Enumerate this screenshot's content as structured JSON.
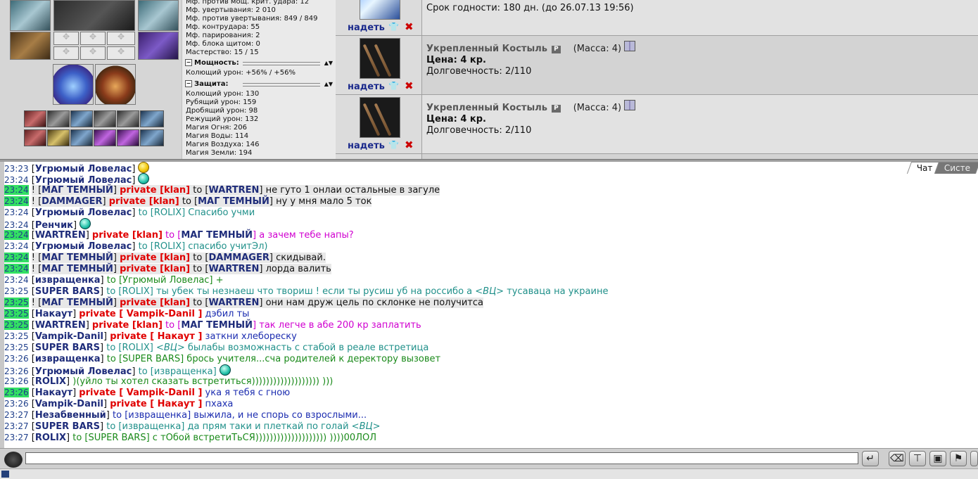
{
  "stats": {
    "lines_top": [
      "Мф. против мощ. крит. удара: 12",
      "Мф. увертывания: 2 010",
      "Мф. против увертывания: 849 / 849",
      "Мф. контрудара: 55",
      "Мф. парирования: 2",
      "Мф. блока щитом: 0",
      "Мастерство: 15 / 15"
    ],
    "power_section": {
      "title": "Мощность:",
      "lines": [
        "Колющий урон: +56% / +56%"
      ]
    },
    "defense_section": {
      "title": "Защита:",
      "lines": [
        "Колющий урон: 130",
        "Рубящий урон: 159",
        "Дробящий урон: 98",
        "Режущий урон: 132",
        "Магия Огня: 206",
        "Магия Воды: 114",
        "Магия Воздуха: 146",
        "Магия Земли: 194"
      ]
    }
  },
  "items": {
    "first": {
      "expiry": "Срок годности: 180 дн. (до 26.07.13 19:56)",
      "put_label": "надеть"
    },
    "list": [
      {
        "name": "Укрепленный Костыль",
        "badge": "P",
        "mass": "(Масса: 4)",
        "price": "Цена: 4 кр.",
        "durability": "Долговечность: 2/110",
        "put_label": "надеть"
      },
      {
        "name": "Укрепленный Костыль",
        "badge": "P",
        "mass": "(Масса: 4)",
        "price": "Цена: 4 кр.",
        "durability": "Долговечность: 2/110",
        "put_label": "надеть"
      }
    ]
  },
  "chat": {
    "tabs": [
      "Чат",
      "Систе"
    ],
    "lines": [
      {
        "time": "23:23",
        "priv": false,
        "parts": [
          {
            "t": "[",
            "c": "c-black"
          },
          {
            "t": "Угрюмый Ловелас",
            "c": "nm"
          },
          {
            "t": "]",
            "c": "c-black"
          }
        ],
        "smile": "yellow"
      },
      {
        "time": "23:24",
        "priv": false,
        "parts": [
          {
            "t": "[",
            "c": "c-black"
          },
          {
            "t": "Угрюмый Ловелас",
            "c": "nm"
          },
          {
            "t": "]",
            "c": "c-black"
          }
        ],
        "smile": "cyan"
      },
      {
        "time": "23:24",
        "priv": true,
        "parts": [
          {
            "t": "! [",
            "c": "c-black hl"
          },
          {
            "t": "МАГ ТЕМНЫЙ",
            "c": "nm hl"
          },
          {
            "t": "] ",
            "c": "c-black hl"
          },
          {
            "t": "private [klan]",
            "c": "pv hl"
          },
          {
            "t": " to [",
            "c": "c-black hl"
          },
          {
            "t": "WARTREN",
            "c": "nm hl"
          },
          {
            "t": "] не гуто 1 онлаи остальные в загуле",
            "c": "c-black hl"
          }
        ]
      },
      {
        "time": "23:24",
        "priv": true,
        "parts": [
          {
            "t": "! [",
            "c": "c-black hl"
          },
          {
            "t": "DAMMAGER",
            "c": "nm hl"
          },
          {
            "t": "] ",
            "c": "c-black hl"
          },
          {
            "t": "private [klan]",
            "c": "pv hl"
          },
          {
            "t": " to [",
            "c": "c-black hl"
          },
          {
            "t": "МАГ ТЕМНЫЙ",
            "c": "nm hl"
          },
          {
            "t": "] ну у мня мало 5 ток",
            "c": "c-black hl"
          }
        ]
      },
      {
        "time": "23:24",
        "priv": false,
        "parts": [
          {
            "t": "[",
            "c": "c-black"
          },
          {
            "t": "Угрюмый Ловелас",
            "c": "nm"
          },
          {
            "t": "] ",
            "c": "c-black"
          },
          {
            "t": "to [ROLIX] Спасибо учми",
            "c": "c-teal"
          }
        ]
      },
      {
        "time": "23:24",
        "priv": false,
        "parts": [
          {
            "t": "[",
            "c": "c-black"
          },
          {
            "t": "Ренчик",
            "c": "nm"
          },
          {
            "t": "]",
            "c": "c-black"
          }
        ],
        "smile": "cyan"
      },
      {
        "time": "23:24",
        "priv": true,
        "parts": [
          {
            "t": "[",
            "c": "c-black"
          },
          {
            "t": "WARTREN",
            "c": "nm"
          },
          {
            "t": "] ",
            "c": "c-black"
          },
          {
            "t": "private [klan]",
            "c": "pv"
          },
          {
            "t": " to [",
            "c": "c-mag"
          },
          {
            "t": "МАГ ТЕМНЫЙ",
            "c": "nm"
          },
          {
            "t": "] а зачем тебе напы?",
            "c": "c-mag"
          }
        ]
      },
      {
        "time": "23:24",
        "priv": false,
        "parts": [
          {
            "t": "[",
            "c": "c-black"
          },
          {
            "t": "Угрюмый Ловелас",
            "c": "nm"
          },
          {
            "t": "] ",
            "c": "c-black"
          },
          {
            "t": "to [ROLIX] спасибо учитЭл)",
            "c": "c-teal"
          }
        ]
      },
      {
        "time": "23:24",
        "priv": true,
        "parts": [
          {
            "t": "! [",
            "c": "c-black hl"
          },
          {
            "t": "МАГ ТЕМНЫЙ",
            "c": "nm hl"
          },
          {
            "t": "] ",
            "c": "c-black hl"
          },
          {
            "t": "private [klan]",
            "c": "pv hl"
          },
          {
            "t": " to [",
            "c": "c-black hl"
          },
          {
            "t": "DAMMAGER",
            "c": "nm hl"
          },
          {
            "t": "] скидывай.",
            "c": "c-black hl"
          }
        ]
      },
      {
        "time": "23:24",
        "priv": true,
        "parts": [
          {
            "t": "! [",
            "c": "c-black hl"
          },
          {
            "t": "МАГ ТЕМНЫЙ",
            "c": "nm hl"
          },
          {
            "t": "] ",
            "c": "c-black hl"
          },
          {
            "t": "private [klan]",
            "c": "pv hl"
          },
          {
            "t": " to [",
            "c": "c-black hl"
          },
          {
            "t": "WARTREN",
            "c": "nm hl"
          },
          {
            "t": "] лорда валить",
            "c": "c-black hl"
          }
        ]
      },
      {
        "time": "23:24",
        "priv": false,
        "parts": [
          {
            "t": "[",
            "c": "c-black"
          },
          {
            "t": "извращенка",
            "c": "nm"
          },
          {
            "t": "] ",
            "c": "c-black"
          },
          {
            "t": "to [Угрюмый Ловелас] +",
            "c": "c-green"
          }
        ]
      },
      {
        "time": "23:25",
        "priv": false,
        "parts": [
          {
            "t": "[",
            "c": "c-black"
          },
          {
            "t": "SUPER BARS",
            "c": "nm"
          },
          {
            "t": "] ",
            "c": "c-black"
          },
          {
            "t": "to [ROLIX] ты убек ты незнаеш что твориш ! если ты русиш уб на россибо а ",
            "c": "c-teal"
          },
          {
            "t": "<ВЦ>",
            "c": "c-teal vc"
          },
          {
            "t": " тусаваца на украине",
            "c": "c-teal"
          }
        ]
      },
      {
        "time": "23:25",
        "priv": true,
        "parts": [
          {
            "t": "! [",
            "c": "c-black hl"
          },
          {
            "t": "МАГ ТЕМНЫЙ",
            "c": "nm hl"
          },
          {
            "t": "] ",
            "c": "c-black hl"
          },
          {
            "t": "private [klan]",
            "c": "pv hl"
          },
          {
            "t": " to [",
            "c": "c-black hl"
          },
          {
            "t": "WARTREN",
            "c": "nm hl"
          },
          {
            "t": "] они нам друж цель по склонке не получитса",
            "c": "c-black hl"
          }
        ]
      },
      {
        "time": "23:25",
        "priv": true,
        "parts": [
          {
            "t": "[",
            "c": "c-black"
          },
          {
            "t": "Накаут",
            "c": "nm"
          },
          {
            "t": "] ",
            "c": "c-black"
          },
          {
            "t": "private [ Vampik-Danil ]",
            "c": "pv"
          },
          {
            "t": " дэбил ты",
            "c": "c-blue"
          }
        ]
      },
      {
        "time": "23:25",
        "priv": true,
        "parts": [
          {
            "t": "[",
            "c": "c-black"
          },
          {
            "t": "WARTREN",
            "c": "nm"
          },
          {
            "t": "] ",
            "c": "c-black"
          },
          {
            "t": "private [klan]",
            "c": "pv"
          },
          {
            "t": " to [",
            "c": "c-mag"
          },
          {
            "t": "МАГ ТЕМНЫЙ",
            "c": "nm"
          },
          {
            "t": "] так легче в абе 200 кр заплатить",
            "c": "c-mag"
          }
        ]
      },
      {
        "time": "23:25",
        "priv": false,
        "parts": [
          {
            "t": "[",
            "c": "c-black"
          },
          {
            "t": "Vampik-Danil",
            "c": "nm"
          },
          {
            "t": "] ",
            "c": "c-black"
          },
          {
            "t": "private [ Накаут ]",
            "c": "pv"
          },
          {
            "t": " заткни хлебореску",
            "c": "c-blue"
          }
        ]
      },
      {
        "time": "23:25",
        "priv": false,
        "parts": [
          {
            "t": "[",
            "c": "c-black"
          },
          {
            "t": "SUPER BARS",
            "c": "nm"
          },
          {
            "t": "] ",
            "c": "c-black"
          },
          {
            "t": "to [ROLIX] ",
            "c": "c-teal"
          },
          {
            "t": "<ВЦ>",
            "c": "c-teal vc"
          },
          {
            "t": " былабы возможнасть с стабой в реале встретица",
            "c": "c-teal"
          }
        ]
      },
      {
        "time": "23:26",
        "priv": false,
        "parts": [
          {
            "t": "[",
            "c": "c-black"
          },
          {
            "t": "извращенка",
            "c": "nm"
          },
          {
            "t": "] ",
            "c": "c-black"
          },
          {
            "t": "to [SUPER BARS] брось учителя...сча родителей к деректору вызовет",
            "c": "c-green"
          }
        ]
      },
      {
        "time": "23:26",
        "priv": false,
        "parts": [
          {
            "t": "[",
            "c": "c-black"
          },
          {
            "t": "Угрюмый Ловелас",
            "c": "nm"
          },
          {
            "t": "] ",
            "c": "c-black"
          },
          {
            "t": "to [извращенка]",
            "c": "c-teal"
          }
        ],
        "smile": "cyan"
      },
      {
        "time": "23:26",
        "priv": false,
        "parts": [
          {
            "t": "[",
            "c": "c-black"
          },
          {
            "t": "ROLIX",
            "c": "nm"
          },
          {
            "t": "] ",
            "c": "c-black"
          },
          {
            "t": ")(уйло ты хотел сказать встретиться))))))))))))))))))) )))",
            "c": "c-green"
          }
        ]
      },
      {
        "time": "23:26",
        "priv": true,
        "parts": [
          {
            "t": "[",
            "c": "c-black"
          },
          {
            "t": "Накаут",
            "c": "nm"
          },
          {
            "t": "] ",
            "c": "c-black"
          },
          {
            "t": "private [ Vampik-Danil ]",
            "c": "pv"
          },
          {
            "t": " ука я тебя с гною",
            "c": "c-blue"
          }
        ]
      },
      {
        "time": "23:26",
        "priv": false,
        "parts": [
          {
            "t": "[",
            "c": "c-black"
          },
          {
            "t": "Vampik-Danil",
            "c": "nm"
          },
          {
            "t": "] ",
            "c": "c-black"
          },
          {
            "t": "private [ Накаут ]",
            "c": "pv"
          },
          {
            "t": " пхаха",
            "c": "c-blue"
          }
        ]
      },
      {
        "time": "23:27",
        "priv": false,
        "parts": [
          {
            "t": "[",
            "c": "c-black"
          },
          {
            "t": "Незабвенный",
            "c": "nm"
          },
          {
            "t": "] ",
            "c": "c-black"
          },
          {
            "t": "to [извращенка] выжила, и не спорь со взрослыми...",
            "c": "c-blue"
          }
        ]
      },
      {
        "time": "23:27",
        "priv": false,
        "parts": [
          {
            "t": "[",
            "c": "c-black"
          },
          {
            "t": "SUPER BARS",
            "c": "nm"
          },
          {
            "t": "] ",
            "c": "c-black"
          },
          {
            "t": "to [извращенка] да прям таки и плеткай по голай ",
            "c": "c-teal"
          },
          {
            "t": "<ВЦ>",
            "c": "c-teal vc"
          }
        ]
      },
      {
        "time": "23:27",
        "priv": false,
        "parts": [
          {
            "t": "[",
            "c": "c-black"
          },
          {
            "t": "ROLIX",
            "c": "nm"
          },
          {
            "t": "] ",
            "c": "c-black"
          },
          {
            "t": "to [SUPER BARS] с тОбой встретиТьСЯ)))))))))))))))))))) ))))00ЛОЛ",
            "c": "c-green"
          }
        ]
      }
    ]
  },
  "input": {
    "value": "",
    "placeholder": ""
  },
  "tools": [
    "enter-icon",
    "eraser-icon",
    "filter-icon",
    "save-icon",
    "run-icon",
    "settings-icon"
  ]
}
